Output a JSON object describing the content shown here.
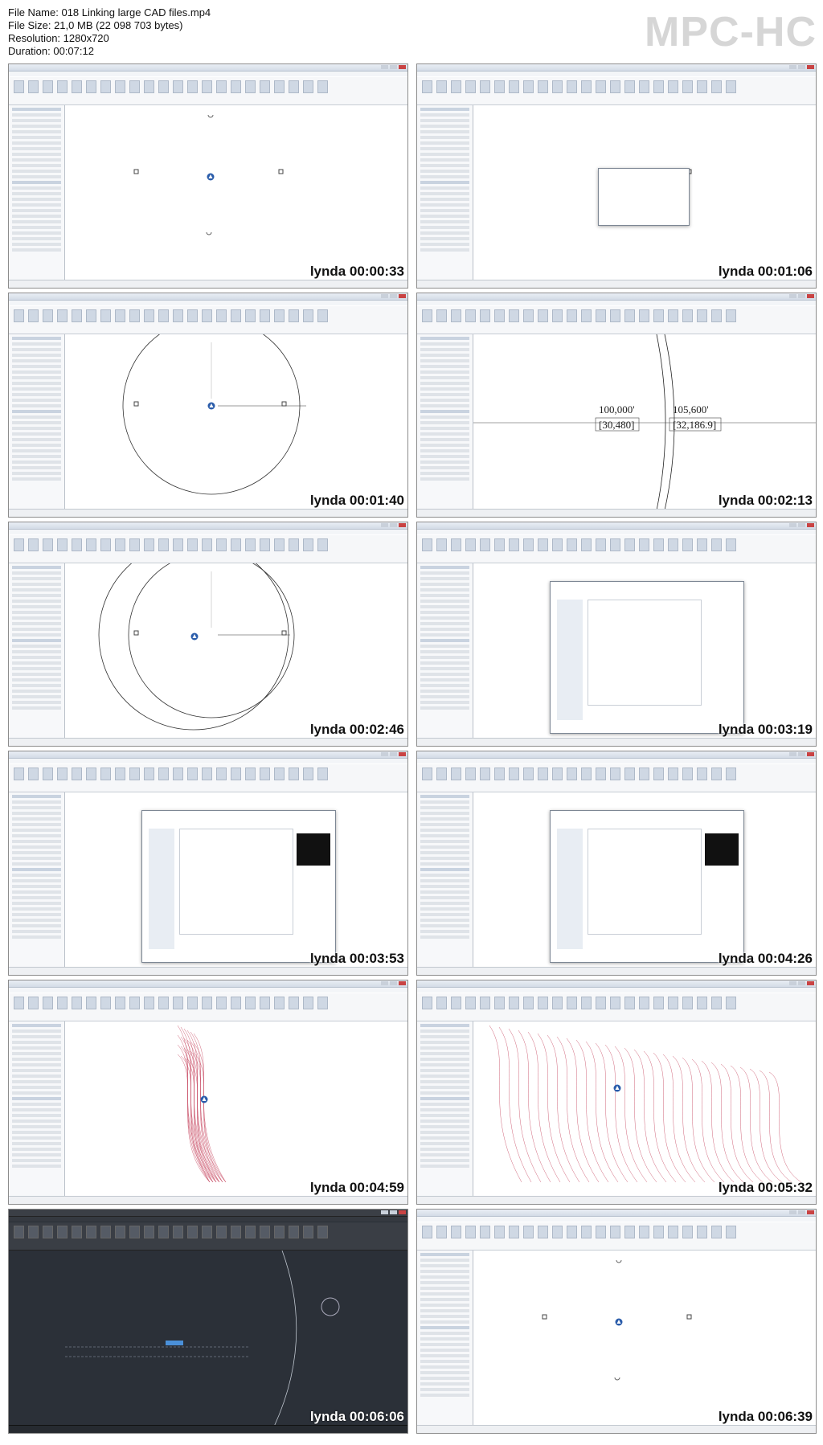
{
  "header": {
    "file_name": "File Name: 018 Linking large CAD files.mp4",
    "file_size": "File Size: 21,0 MB (22 098 703 bytes)",
    "resolution": "Resolution: 1280x720",
    "duration": "Duration: 00:07:12"
  },
  "logo": "MPC-HC",
  "thumbnails": [
    {
      "stamp": "lynda 00:00:33",
      "scene": "plan"
    },
    {
      "stamp": "lynda 00:01:06",
      "scene": "alert"
    },
    {
      "stamp": "lynda 00:01:40",
      "scene": "circle"
    },
    {
      "stamp": "lynda 00:02:13",
      "scene": "dims"
    },
    {
      "stamp": "lynda 00:02:46",
      "scene": "circle2"
    },
    {
      "stamp": "lynda 00:03:19",
      "scene": "filedlg"
    },
    {
      "stamp": "lynda 00:03:53",
      "scene": "filedlg"
    },
    {
      "stamp": "lynda 00:04:26",
      "scene": "filedlg"
    },
    {
      "stamp": "lynda 00:04:59",
      "scene": "site"
    },
    {
      "stamp": "lynda 00:05:32",
      "scene": "site2"
    },
    {
      "stamp": "lynda 00:06:06",
      "scene": "autocad"
    },
    {
      "stamp": "lynda 00:06:39",
      "scene": "plan"
    }
  ],
  "dimensions": {
    "a_top": "100,000'",
    "a_bottom": "[30,480]",
    "b_top": "105,600'",
    "b_bottom": "[32,186.9]"
  },
  "colors": {
    "window_chrome": "#d3dbe6",
    "canvas": "#ffffff",
    "site_lines": "#c4405a",
    "autocad_bg": "#2b3038",
    "compass": "#2a5caa"
  }
}
